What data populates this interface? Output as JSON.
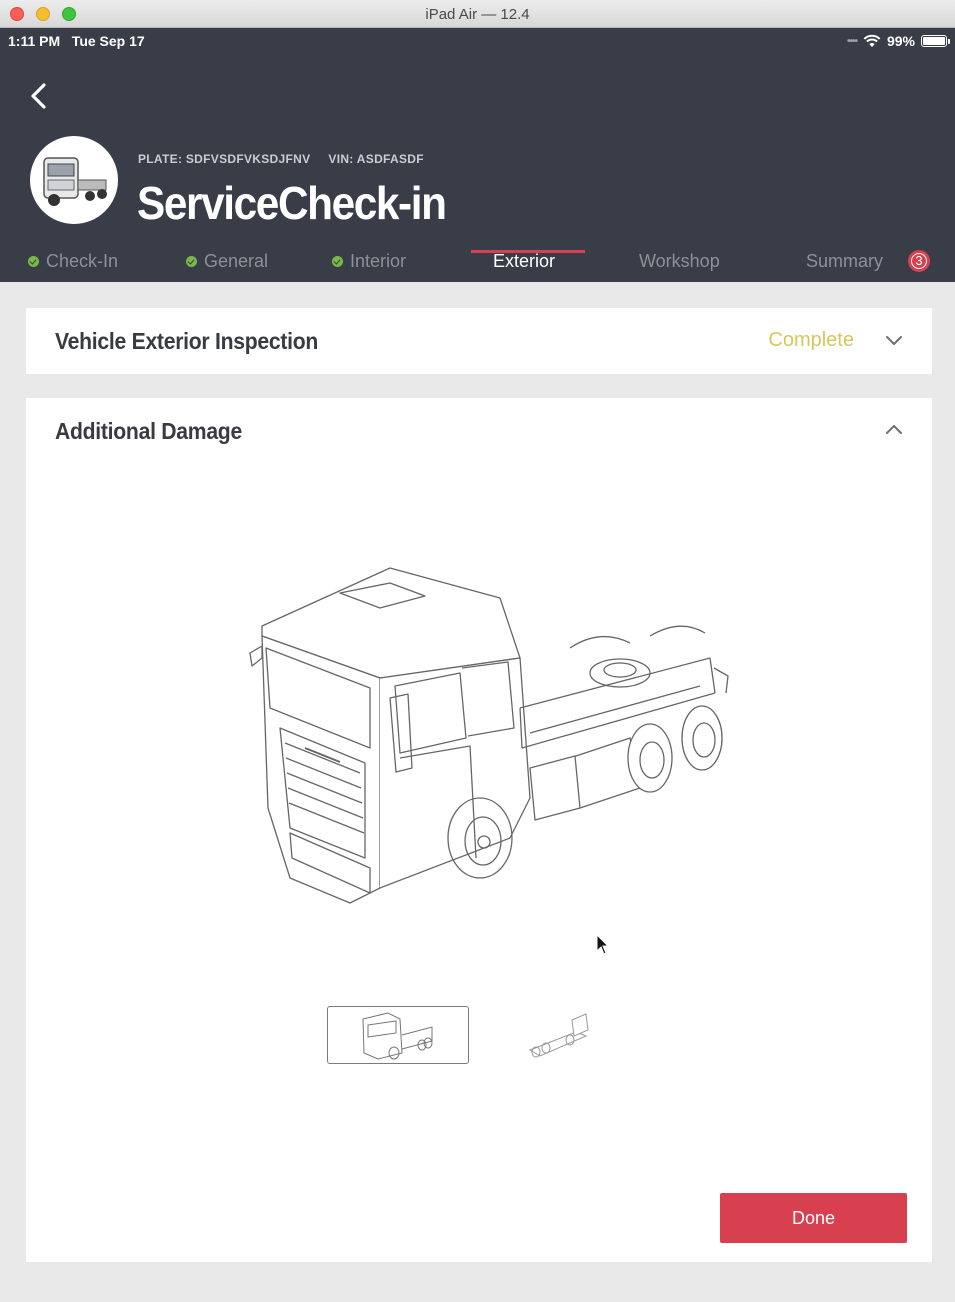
{
  "window": {
    "title": "iPad Air — 12.4"
  },
  "status_bar": {
    "time_date": "1:11 PM   Tue Sep 17",
    "battery": "99%"
  },
  "header": {
    "plate": "PLATE: SDFVSDFVKSDJFNV",
    "vin": "VIN: ASDFASDF",
    "title": "ServiceCheck-in"
  },
  "tabs": [
    {
      "label": "Check-In",
      "completed": true
    },
    {
      "label": "General",
      "completed": true
    },
    {
      "label": "Interior",
      "completed": true
    },
    {
      "label": "Exterior",
      "active": true
    },
    {
      "label": "Workshop"
    },
    {
      "label": "Summary",
      "badge": "3"
    }
  ],
  "sections": {
    "vehicle_exterior": {
      "title": "Vehicle Exterior Inspection",
      "status": "Complete",
      "expanded": false
    },
    "additional_damage": {
      "title": "Additional Damage",
      "expanded": true
    }
  },
  "done_button": "Done",
  "colors": {
    "header_bg": "#393d47",
    "accent": "#d9404f",
    "complete": "#d7c65a",
    "check": "#7ab648"
  }
}
